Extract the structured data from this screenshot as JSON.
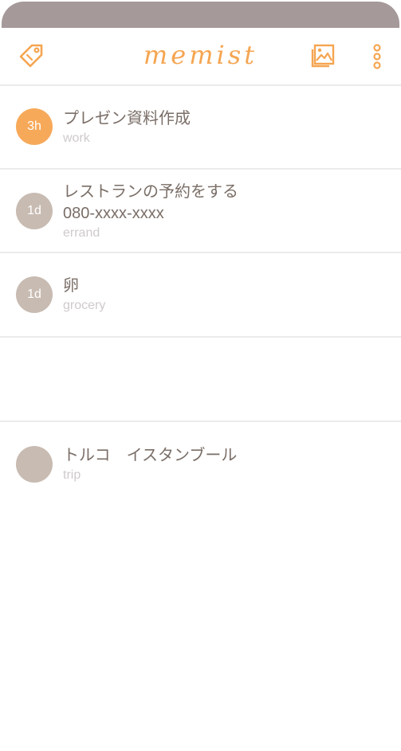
{
  "app": {
    "logo": "memist",
    "colors": {
      "accent": "#f5a551",
      "statusbar": "#a5999a",
      "badge_due_soon": "#f7a95a",
      "badge_default": "#c8bbb2",
      "title_text": "#7a6e67",
      "category_text": "#cfcaca"
    }
  },
  "toolbar": {
    "left_icon": "tag-icon",
    "right_icons": [
      "image-gallery-icon",
      "more-vertical-icon"
    ]
  },
  "memos": [
    {
      "badge": "3h",
      "title": "プレゼン資料作成",
      "subtitle": "",
      "category": "work"
    },
    {
      "badge": "1d",
      "title": "レストランの予約をする",
      "subtitle": "080-xxxx-xxxx",
      "category": "errand"
    },
    {
      "badge": "1d",
      "title": "卵",
      "subtitle": "",
      "category": "grocery"
    },
    {
      "badge": "",
      "title": "",
      "subtitle": "",
      "category": ""
    },
    {
      "badge": "",
      "title": "トルコ　イスタンブール",
      "subtitle": "",
      "category": "trip"
    }
  ]
}
